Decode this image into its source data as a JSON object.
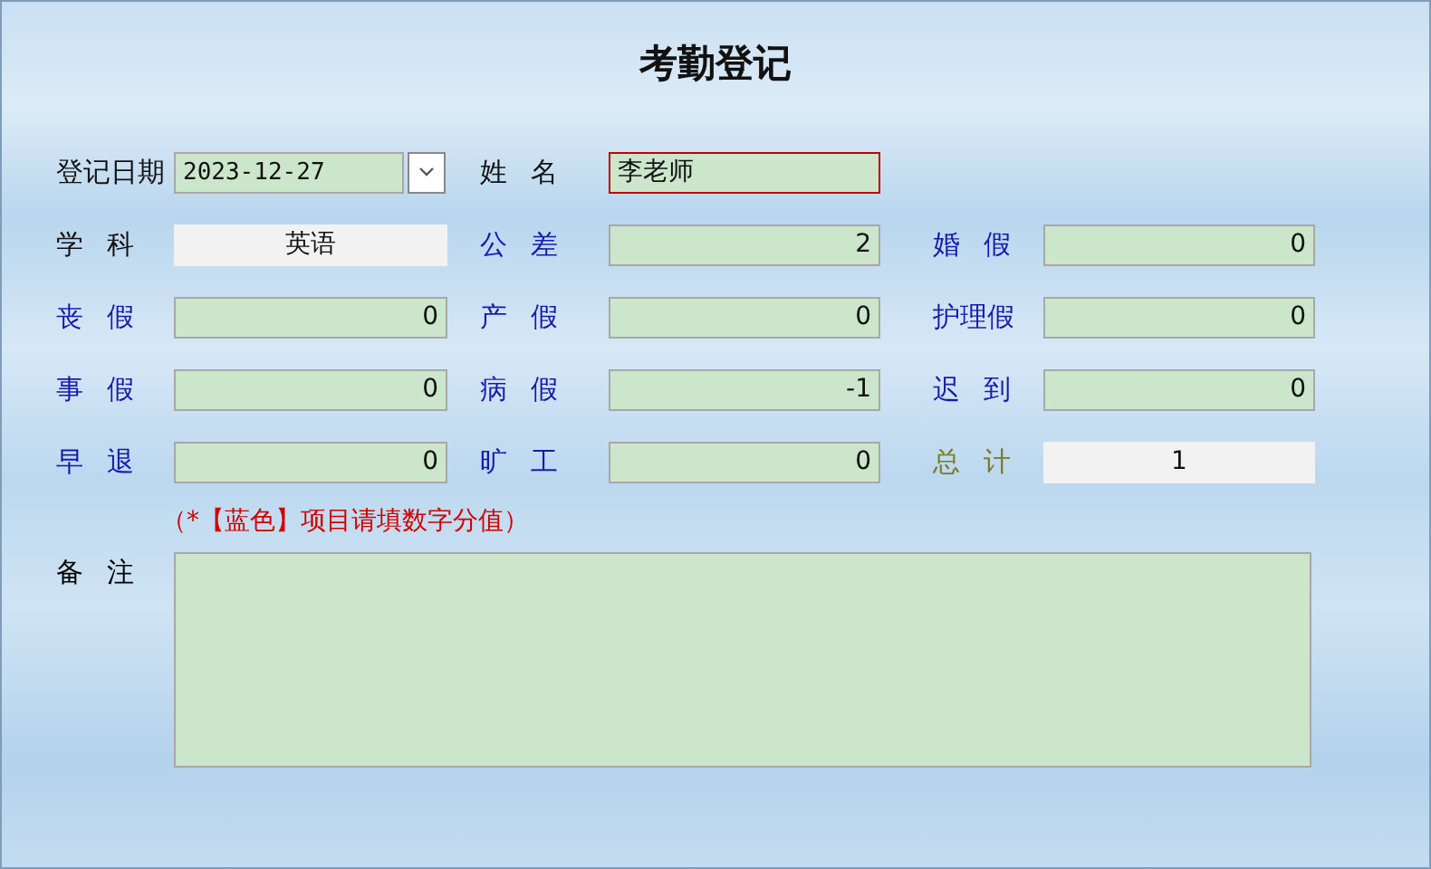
{
  "title": "考勤登记",
  "rows": [
    [
      {
        "label": "登记日期",
        "kind": "plain",
        "field": {
          "kind": "date",
          "value": "2023-12-27"
        }
      },
      {
        "label": "姓 名",
        "kind": "plain",
        "field": {
          "kind": "text",
          "value": "李老师",
          "focused": true
        }
      }
    ],
    [
      {
        "label": "学 科",
        "kind": "plain",
        "field": {
          "kind": "display",
          "value": "英语"
        }
      },
      {
        "label": "公 差",
        "kind": "numeric",
        "field": {
          "kind": "number",
          "value": "2"
        }
      },
      {
        "label": "婚 假",
        "kind": "numeric",
        "field": {
          "kind": "number",
          "value": "0"
        }
      }
    ],
    [
      {
        "label": "丧 假",
        "kind": "numeric",
        "field": {
          "kind": "number",
          "value": "0"
        }
      },
      {
        "label": "产 假",
        "kind": "numeric",
        "field": {
          "kind": "number",
          "value": "0"
        }
      },
      {
        "label": "护理假",
        "kind": "numeric",
        "field": {
          "kind": "number",
          "value": "0"
        }
      }
    ],
    [
      {
        "label": "事 假",
        "kind": "numeric",
        "field": {
          "kind": "number",
          "value": "0"
        }
      },
      {
        "label": "病 假",
        "kind": "numeric",
        "field": {
          "kind": "number",
          "value": "-1"
        }
      },
      {
        "label": "迟 到",
        "kind": "numeric",
        "field": {
          "kind": "number",
          "value": "0"
        }
      }
    ],
    [
      {
        "label": "早 退",
        "kind": "numeric",
        "field": {
          "kind": "number",
          "value": "0"
        }
      },
      {
        "label": "旷 工",
        "kind": "numeric",
        "field": {
          "kind": "number",
          "value": "0"
        }
      },
      {
        "label": "总 计",
        "kind": "total",
        "field": {
          "kind": "display",
          "value": "1"
        }
      }
    ]
  ],
  "note": "（*【蓝色】项目请填数字分值）",
  "remarks": {
    "label": "备 注"
  }
}
